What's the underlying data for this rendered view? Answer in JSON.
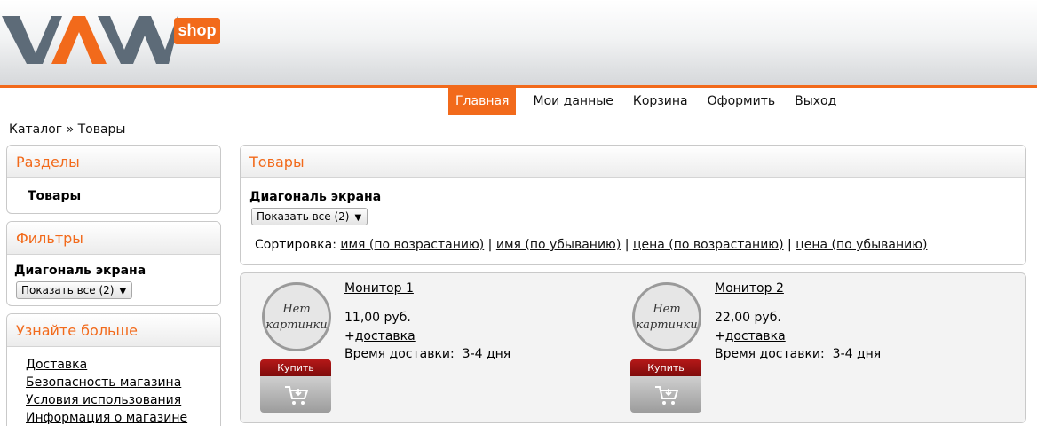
{
  "brand": {
    "logo_text": "VAM",
    "badge": "shop",
    "accent": "#f26a1b",
    "logo_dark": "#5d6b78"
  },
  "nav": {
    "items": [
      "Главная",
      "Мои данные",
      "Корзина",
      "Оформить",
      "Выход"
    ],
    "active_index": 0
  },
  "breadcrumb": "Каталог » Товары",
  "sidebar": {
    "sections": {
      "title": "Разделы",
      "items": [
        "Товары"
      ]
    },
    "filters": {
      "title": "Фильтры",
      "label": "Диагональ экрана",
      "select_value": "Показать все (2)"
    },
    "more": {
      "title": "Узнайте больше",
      "links": [
        "Доставка",
        "Безопасность магазина",
        "Условия использования",
        "Информация о магазине"
      ]
    }
  },
  "products_box": {
    "title": "Товары",
    "filter_label": "Диагональ экрана",
    "select_value": "Показать все (2)",
    "sort_label": "Сортировка:",
    "sort_options": [
      "имя (по возрастанию)",
      "имя (по убыванию)",
      "цена (по возрастанию)",
      "цена (по убыванию)"
    ],
    "separator": "|"
  },
  "products": [
    {
      "name": "Монитор 1",
      "no_image": [
        "Нет",
        "картинки"
      ],
      "price": "11,00 руб.",
      "shipping_prefix": "+",
      "shipping_link": "доставка",
      "delivery_label": "Время доставки:",
      "delivery_value": "3-4 дня",
      "buy_label": "Купить",
      "icon": "cart-icon"
    },
    {
      "name": "Монитор 2",
      "no_image": [
        "Нет",
        "картинки"
      ],
      "price": "22,00 руб.",
      "shipping_prefix": "+",
      "shipping_link": "доставка",
      "delivery_label": "Время доставки:",
      "delivery_value": "3-4 дня",
      "buy_label": "Купить",
      "icon": "cart-icon"
    }
  ]
}
